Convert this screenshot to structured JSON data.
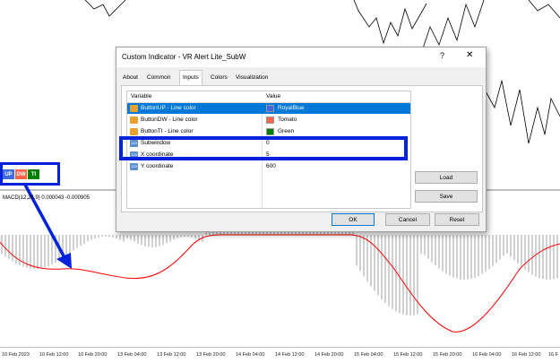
{
  "chart": {
    "macd_label": "MACD(12,26,9) 0.000043 -0.000905",
    "indicator_buttons": [
      {
        "label": "UP",
        "color": "#4169e1"
      },
      {
        "label": "DW",
        "color": "#ff6347"
      },
      {
        "label": "TI",
        "color": "#008000"
      }
    ],
    "time_axis": [
      "10 Feb 2023",
      "10 Feb 12:00",
      "10 Feb 20:00",
      "13 Feb 04:00",
      "13 Feb 12:00",
      "13 Feb 20:00",
      "14 Feb 04:00",
      "14 Feb 12:00",
      "14 Feb 20:00",
      "15 Feb 04:00",
      "15 Feb 12:00",
      "15 Feb 20:00",
      "16 Feb 04:00",
      "16 Feb 12:00",
      "16 F"
    ]
  },
  "dialog": {
    "title": "Custom Indicator - VR Alert Lite_SubW",
    "help": "?",
    "close": "✕",
    "tabs": [
      "About",
      "Common",
      "Inputs",
      "Colors",
      "Visualization"
    ],
    "active_tab": "Inputs",
    "columns": {
      "variable": "Variable",
      "value": "Value"
    },
    "rows": [
      {
        "icon": "color-icon",
        "name": "ButtonUP - Line color",
        "value": "RoyalBlue",
        "swatch": "#4169e1",
        "selected": true
      },
      {
        "icon": "color-icon",
        "name": "ButtonDW - Line color",
        "value": "Tomato",
        "swatch": "#ff6347"
      },
      {
        "icon": "color-icon",
        "name": "ButtonTI - Line color",
        "value": "Green",
        "swatch": "#008000"
      },
      {
        "icon": "number-icon",
        "name": "Subwindow",
        "value": "0"
      },
      {
        "icon": "number-icon",
        "name": "X coordinate",
        "value": "5"
      },
      {
        "icon": "number-icon",
        "name": "Y coordinate",
        "value": "600"
      }
    ],
    "buttons": {
      "load": "Load",
      "save": "Save",
      "ok": "OK",
      "cancel": "Cancel",
      "reset": "Reset"
    }
  },
  "colors": {
    "highlight": "#0022dd",
    "selection": "#0078d7",
    "signal_line": "#ff0000",
    "histogram": "#c0c0c0"
  }
}
